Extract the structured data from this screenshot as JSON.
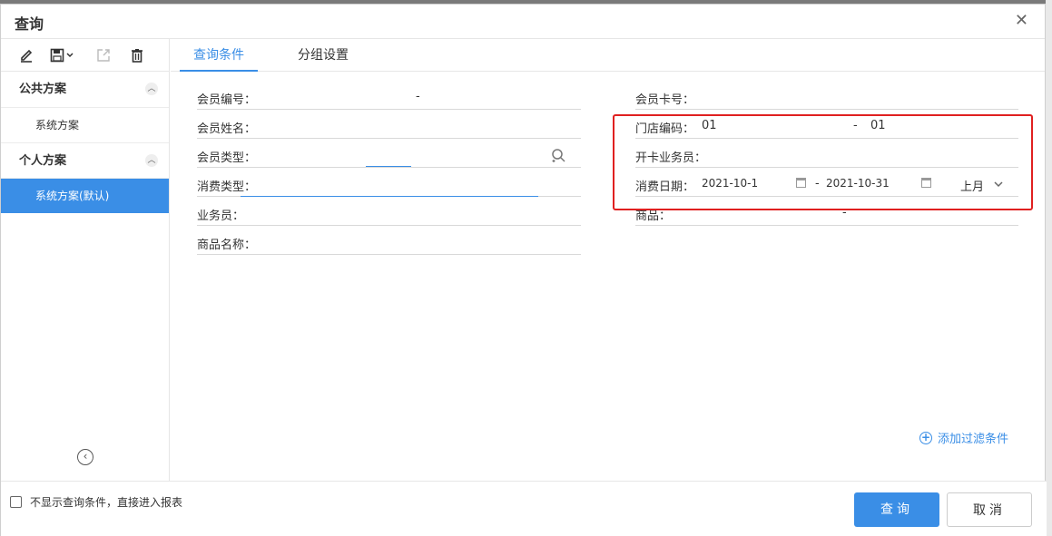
{
  "dialog": {
    "title": "查询",
    "close": "✕"
  },
  "sidebar": {
    "toolbar": [
      "edit-icon",
      "save-icon",
      "export-icon",
      "delete-icon"
    ],
    "public_group": "公共方案",
    "public_items": [
      "系统方案"
    ],
    "personal_group": "个人方案",
    "personal_items": [
      "系统方案(默认)"
    ],
    "collapse": "‹"
  },
  "tabs": [
    {
      "label": "查询条件",
      "active": true
    },
    {
      "label": "分组设置",
      "active": false
    }
  ],
  "left_fields": {
    "member_no": {
      "label": "会员编号：",
      "dash": "-"
    },
    "member_name": {
      "label": "会员姓名："
    },
    "member_type": {
      "label": "会员类型："
    },
    "consume_type": {
      "label": "消费类型："
    },
    "salesman": {
      "label": "业务员："
    },
    "product_name": {
      "label": "商品名称："
    }
  },
  "right_fields": {
    "card_no": {
      "label": "会员卡号："
    },
    "store_code": {
      "label": "门店编码：",
      "from": "01",
      "dash": "-",
      "to": "01"
    },
    "card_salesman": {
      "label": "开卡业务员："
    },
    "consume_date": {
      "label": "消费日期：",
      "from": "2021-10-1",
      "dash": "-",
      "to": "2021-10-31",
      "period": "上月"
    },
    "product": {
      "label": "商品：",
      "dash": "-"
    }
  },
  "add_filter": "添加过滤条件",
  "footer": {
    "checkbox_label": "不显示查询条件，直接进入报表",
    "query_button": "查询",
    "cancel_button": "取消"
  },
  "colors": {
    "accent": "#3a8ee6",
    "highlight": "#e02020"
  }
}
